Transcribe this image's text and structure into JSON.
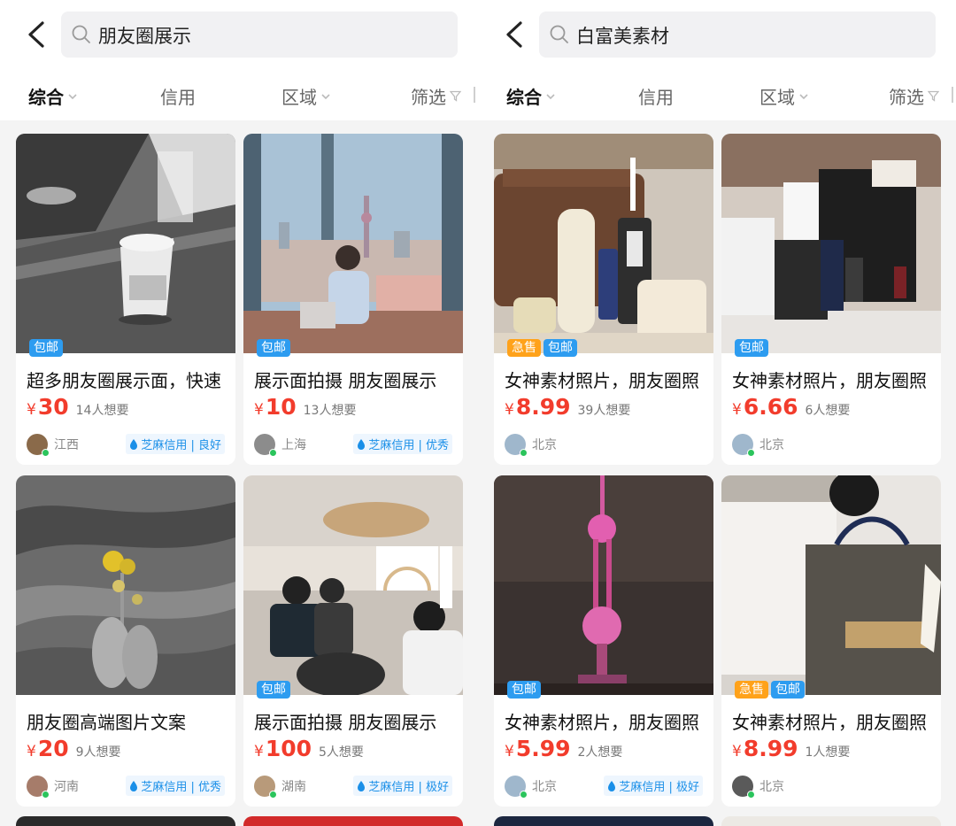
{
  "panels": [
    {
      "search_query": "朋友圈展示",
      "filters": {
        "sort": "综合",
        "credit": "信用",
        "region": "区域",
        "screen": "筛选"
      },
      "cards": [
        {
          "tags": [
            "包邮"
          ],
          "title": "超多朋友圈展示面，快速",
          "currency": "¥",
          "price": "30",
          "wants": "14人想要",
          "location": "江西",
          "credit": "芝麻信用 | 良好"
        },
        {
          "tags": [
            "包邮"
          ],
          "title": "展示面拍摄 朋友圈展示",
          "currency": "¥",
          "price": "10",
          "wants": "13人想要",
          "location": "上海",
          "credit": "芝麻信用 | 优秀"
        },
        {
          "tags": [],
          "title": "朋友圈高端图片文案",
          "currency": "¥",
          "price": "20",
          "wants": "9人想要",
          "location": "河南",
          "credit": "芝麻信用 | 优秀"
        },
        {
          "tags": [
            "包邮"
          ],
          "title": "展示面拍摄 朋友圈展示",
          "currency": "¥",
          "price": "100",
          "wants": "5人想要",
          "location": "湖南",
          "credit": "芝麻信用 | 极好"
        }
      ]
    },
    {
      "search_query": "白富美素材",
      "filters": {
        "sort": "综合",
        "credit": "信用",
        "region": "区域",
        "screen": "筛选"
      },
      "cards": [
        {
          "tags": [
            "急售",
            "包邮"
          ],
          "title": "女神素材照片，朋友圈照",
          "currency": "¥",
          "price": "8.99",
          "wants": "39人想要",
          "location": "北京",
          "credit": ""
        },
        {
          "tags": [
            "包邮"
          ],
          "title": "女神素材照片，朋友圈照",
          "currency": "¥",
          "price": "6.66",
          "wants": "6人想要",
          "location": "北京",
          "credit": ""
        },
        {
          "tags": [
            "包邮"
          ],
          "title": "女神素材照片，朋友圈照",
          "currency": "¥",
          "price": "5.99",
          "wants": "2人想要",
          "location": "北京",
          "credit": "芝麻信用 | 极好"
        },
        {
          "tags": [
            "急售",
            "包邮"
          ],
          "title": "女神素材照片，朋友圈照",
          "currency": "¥",
          "price": "8.99",
          "wants": "1人想要",
          "location": "北京",
          "credit": ""
        }
      ]
    }
  ],
  "colors": {
    "price": "#f23c2c",
    "free_shipping_tag": "#2d9cf0",
    "urgent_tag": "#ffa21a",
    "credit_text": "#1a8fe8",
    "online_dot": "#2bc45c"
  },
  "icons": {
    "back": "chevron-left-icon",
    "search": "search-icon",
    "dropdown": "chevron-down-icon",
    "filter": "funnel-icon",
    "credit": "sesame-drop-icon"
  }
}
